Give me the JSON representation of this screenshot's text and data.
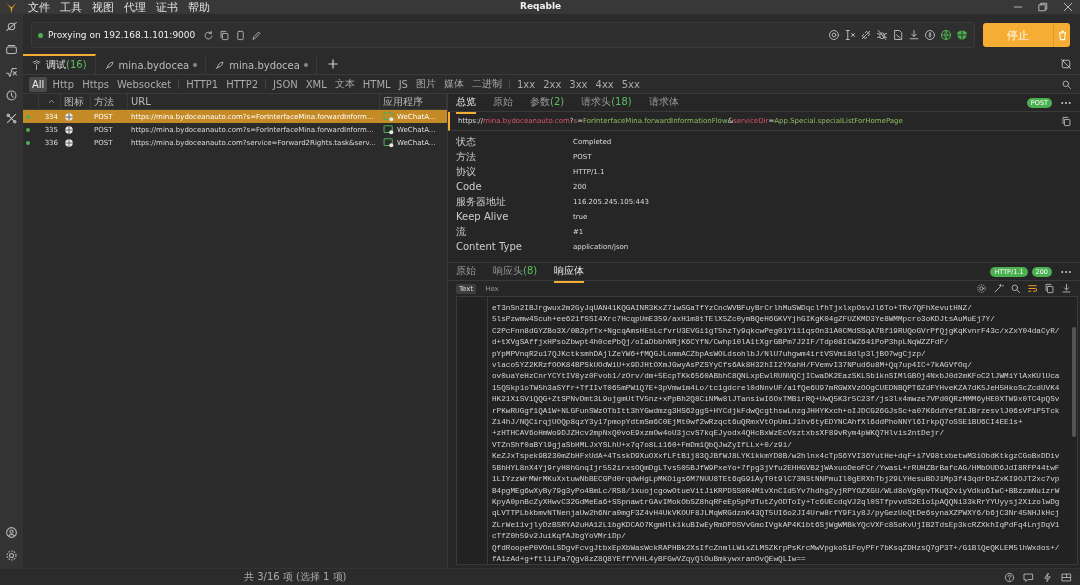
{
  "window": {
    "title": "Reqable",
    "menu": [
      "文件",
      "工具",
      "视图",
      "代理",
      "证书",
      "帮助"
    ]
  },
  "proxy": {
    "status": "Proxying on 192.168.1.101:9000",
    "running": true,
    "stop_button": "停止"
  },
  "session_tabs": [
    {
      "label": "调试",
      "count": "(16)",
      "selected": true,
      "kind": "debug"
    },
    {
      "label": "mina.bydocea",
      "selected": false,
      "kind": "request"
    },
    {
      "label": "mina.bydocea",
      "selected": false,
      "kind": "request"
    }
  ],
  "filters": [
    [
      {
        "label": "All",
        "selected": true
      },
      {
        "label": "Http",
        "selected": false
      },
      {
        "label": "Https",
        "selected": false
      },
      {
        "label": "Websocket",
        "selected": false
      }
    ],
    [
      {
        "label": "HTTP1",
        "selected": false
      },
      {
        "label": "HTTP2",
        "selected": false
      }
    ],
    [
      {
        "label": "JSON",
        "selected": false
      },
      {
        "label": "XML",
        "selected": false
      },
      {
        "label": "文本",
        "selected": false
      },
      {
        "label": "HTML",
        "selected": false
      },
      {
        "label": "JS",
        "selected": false
      },
      {
        "label": "图片",
        "selected": false
      },
      {
        "label": "媒体",
        "selected": false
      },
      {
        "label": "二进制",
        "selected": false
      }
    ],
    [
      {
        "label": "1xx",
        "selected": false
      },
      {
        "label": "2xx",
        "selected": false
      },
      {
        "label": "3xx",
        "selected": false
      },
      {
        "label": "4xx",
        "selected": false
      },
      {
        "label": "5xx",
        "selected": false
      }
    ]
  ],
  "table": {
    "columns": [
      "图标",
      "方法",
      "URL",
      "应用程序"
    ],
    "rows": [
      {
        "id": "334",
        "method": "POST",
        "url": "https://mina.bydoceanauto.com?s=ForInterfaceMina.forwardInform...",
        "app": "WeChatA...",
        "selected": true,
        "color": "#4caf50"
      },
      {
        "id": "335",
        "method": "POST",
        "url": "https://mina.bydoceanauto.com?s=ForInterfaceMina.forwardInform...",
        "app": "WeChatA...",
        "selected": false,
        "color": "#4caf50"
      },
      {
        "id": "336",
        "method": "POST",
        "url": "https://mina.bydoceanauto.com?service=Forward2Rights.task&serv...",
        "app": "WeChatA...",
        "selected": false,
        "color": "#4caf50"
      }
    ]
  },
  "detail": {
    "tabs": [
      {
        "label": "总览",
        "selected": true
      },
      {
        "label": "原始",
        "selected": false
      },
      {
        "label": "参数",
        "count": "(2)",
        "selected": false
      },
      {
        "label": "请求头",
        "count": "(18)",
        "selected": false
      },
      {
        "label": "请求体",
        "selected": false
      }
    ],
    "method_badge": "POST",
    "url": [
      {
        "text": "https://",
        "kind": "scheme"
      },
      {
        "text": "mina.bydoceanauto.com",
        "kind": "host"
      },
      {
        "text": "?",
        "kind": "sep"
      },
      {
        "text": "s",
        "kind": "key"
      },
      {
        "text": "=",
        "kind": "sep"
      },
      {
        "text": "ForInterfaceMina.forwardInformationFlow",
        "kind": "value"
      },
      {
        "text": "&",
        "kind": "sep"
      },
      {
        "text": "serviceDir",
        "kind": "key"
      },
      {
        "text": "=",
        "kind": "sep"
      },
      {
        "text": "App.Special.specialListForHomePage",
        "kind": "value"
      }
    ],
    "fields": [
      {
        "name": "状态",
        "value": "Completed"
      },
      {
        "name": "方法",
        "value": "POST"
      },
      {
        "name": "协议",
        "value": "HTTP/1.1"
      },
      {
        "name": "Code",
        "value": "200"
      },
      {
        "name": "服务器地址",
        "value": "116.205.245.105:443"
      },
      {
        "name": "Keep Alive",
        "value": "true"
      },
      {
        "name": "流",
        "value": "#1"
      },
      {
        "name": "Content Type",
        "value": "application/json"
      }
    ]
  },
  "response": {
    "tabs": [
      {
        "label": "原始",
        "selected": false
      },
      {
        "label": "响应头",
        "count": "(8)",
        "selected": false
      },
      {
        "label": "响应体",
        "selected": true
      }
    ],
    "badges": [
      "HTTP/1.1",
      "200"
    ],
    "view_modes": [
      {
        "label": "Text",
        "selected": true
      },
      {
        "label": "Hex",
        "selected": false
      }
    ],
    "lines": [
      "eT3nSn2IBJrgwux2m2GyJqUAN41KQGAINR3KxZ7iwSGaTfYzCncWVBFuyBrCrlhMuSWDqclfhTjxlxpOsvJl6To+TRv7QFhXevutHNZ/",
      "5lsPzwmw4Scuh+ee621fSSI4Xrc7HcqpUmE359/axH1m8tTElX5Zc0ymBQeH6GKVYjhGIKgK04gZFUZKMD3Ye8WMMpcro3oKDJtsAuMuEj7Y/",
      "C2PcFnn8dGYZBo3X/0B2pfTx+NgcqAmsHEsLcfvrU3EVGi1gT5hzTy9qkcwPeg01Y111qsOn31A0CMdSSqA7Bf19RUQoGVrPfQjgKqKvnrF43c/xZxY04daCyR/",
      "d+tXVgSAffjxHPsoZbwpt4h0cePbQj/oIaDbbhNRjK6CYfN/Cwhp10lA1tXgrGBPm7J2IF/Tdp08ICWZ641PoP3hpLNqWZZFdF/",
      "pYpMPVnqR2u17QJKctksmhDAjlZeYW6+fMQGJLommACZbpAsWOLdsohlbJ/NlU7uhgwm4irtVSVmi8dlp3ljBO7wgCjzp/",
      "vlaco5YZ2KRzfOOK84BPSkUOdWiU+x9DJHtOXmJGwyAsPZSYyCfs6Ak8H32hII2YXahH/FVemvI37NPud6u8M+Qq7up4IC+7kAGVfOq/",
      "ov0uaYeHzCnrYCYtIV8yz0Fvob1/zOrv/dm+5EcpTKk6560ABbhC8QNLxpEwlRUNUQCjICwaDK2EazSKLSb1knSIMlGBOj4NxbJ0d2mKFoC2lJWMiYlAxKUlUca",
      "15QSkp1oTW5h3aSYfr+TfIIvT065mPW1Q7E+3pVmw1m4Lo/tc1gdcrel0dNnvUF/a1fQe6U97mRGWXVzOOgCUEDNBQPT6ZdFYHveKZA7dK5JeH5HkoScZcdUVK4",
      "HK21XiSV1QQG+ZtSPNvDmt3L9ujgmUtTV5nz+xPpBh2Q8CiNMw8lJTansiwI6OxTMBirRQ+UwQ5K3r5C23f/js3lx4mwze7VPd0QRzMMM6yHE0XTW9x0TC4pQSv",
      "rPKwRUGgf1QA1W+NLGFunSWzOTbItt3hYGwdmzg3HS62ggS+HYCdjkFdwQcgthswLnzgJHHYKxch+oIJDCG26GJsSc+a07K6ddYef8IJBrzesvlJ06sVPiP5Tck",
      "Zi4hJ/NQCirqjUOQp8qzY3y17pmopYdtmSm6C0EjMt0wf2wRzqct6uQRmxVtOpUmiJ1hv6tyEDYNCAhfXl6ddPhoNNYl6IrkpQ7oSSE1BU6CI4EE1s+",
      "+zHTHCAV6oHmWo9DJZHcv2mpNxQ0voE9xzmOw4oU3jcvS7kqEJyodx4QHcBxWzEcVsztxbsXF89vRym4pWKQ7Hlvis2ntDejr/",
      "VTZnShf0aBYl9gjaSbHMLJxYSLhU+x7q7o8Li160+FmDm1QbQJwZyIfLLx+0/z9i/",
      "KeZJxTspek9B230mZbHFxUdA+4TsskD9XuOXxfLFtB1j83QJBfWJ8LYK1kkmYD8B/w2hlnx4cTpS6YVI36YutHe+dqF+i7V98txbetwM3iObdKtkgzCGoBxDDiv",
      "5BhHYL8nX4Yj9ryH8hGnqIjr552irxsOQmDgLTvs505BJfW9PxeYo+7fpg3jVfu2EHHGVB2jWAxuoDeoFCr/YwasL+rRUHZBrBafcAG/HMbOUD6JdI8RFP44twF",
      "1LIYzzWrMWrMKuXxtuwNbBECGPd0rqdwHgLpMKOigs6M7NUU8TEt6qG91AyT0t9lC73NStNNPmuIl0gERXhTbj29LYHesuBDJ1Mp3f43qdrDsZxKI9OJT2xc7vp",
      "B4pgMEg6wXyBy79g3yPo4BmLc/RS8/1xuojcgowOtueVitJiKRPDSS0R4M1vXnCId5Yv7hdhg2yjRPYOZXGU/WLd8oVg0pvTKuQ2viyVdku6IwC+BBzzmNuizrW",
      "KpyA0pnBcZyXHwvC32GdMeEa6+SSpnawtrGAvIMokObSZ8hqRFeEp5pPdTutZyODToIy+Tc6UEcdqVJ2ql0STfpvvdS2E1o1pAQQNi33kRrYYUyysj2XizolwDg",
      "qLVTTPLbkbmvNTNenjaUw2h6Nra0mgF3Z4vH4UkVKOUF8JLMqWRGdznK43QT5UI6o2JI4Urw8rfY9Fiy8J/pyGezUoQtDe6synaXZPWXY6/b6jC3Nr45NHJkHcj",
      "ZLrWe11vjlyDzBSRYA2uHA12L1bgKDCAO7KgmHlk1kuBIwEyRmDPDSVvGmoIVgkAP4K1bt6SjWgWMBkYQcVXFc8SoKvUjIB2TdsEp3kcRZXkhIqPdFq4LnjDqV1",
      "cTfZ0h59v2JuiKqfAJbgYoVMriDp/",
      "QfdRoopeP0VOnLSDgvFcvgJtbxEpXbWasWckRAPHBk2XsIfcZnmlLWixZLMSZKrpPsKrcMwVpgkoSiFoyPFr7bKsqZDHzsQ7gP3T+/G1BlQeQKLEM5lhWxdos+/",
      "fA1zAd+g+ftliiPa7Qgv8zZ8Q8YEffYVHL4yBFGwVZqyQlOuBmkywxranOvQEwQLIw=="
    ]
  },
  "status_bar": {
    "text": "共 3/16 项 (选择 1 项)"
  }
}
